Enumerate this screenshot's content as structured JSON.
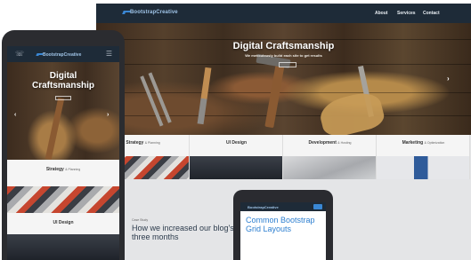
{
  "desktop": {
    "brand": "BootstrapCreative",
    "nav_links": [
      "About",
      "Services",
      "Contact"
    ],
    "hero": {
      "title": "Digital Craftsmanship",
      "subtitle": "We meticulously build each site to get results",
      "prev_arrow": "‹",
      "next_arrow": "›"
    },
    "cards": [
      {
        "title": "Strategy",
        "sub": "& Planning"
      },
      {
        "title": "UI Design",
        "sub": ""
      },
      {
        "title": "Development",
        "sub": "& Hosting"
      },
      {
        "title": "Marketing",
        "sub": "& Optimization"
      }
    ],
    "case_study_label": "Case Study",
    "headline": "How we increased our blog's readership by 45% in three months"
  },
  "inner_phone": {
    "brand": "BootstrapCreative",
    "text": "Common Bootstrap Grid Layouts"
  },
  "phone": {
    "phone_icon": "☏",
    "menu_icon": "☰",
    "brand": "BootstrapCreative",
    "hero_title_line1": "Digital",
    "hero_title_line2": "Craftsmanship",
    "prev_arrow": "‹",
    "next_arrow": "›",
    "card1": {
      "title": "Strategy",
      "sub": "& Planning"
    },
    "card2": {
      "title": "UI Design"
    }
  },
  "colors": {
    "navbar": "#1e2b38",
    "brand_text": "#9fc3e6",
    "accent_blue": "#3a87d4",
    "headline": "#2d3c4d",
    "device_frame": "#2b2c30"
  }
}
